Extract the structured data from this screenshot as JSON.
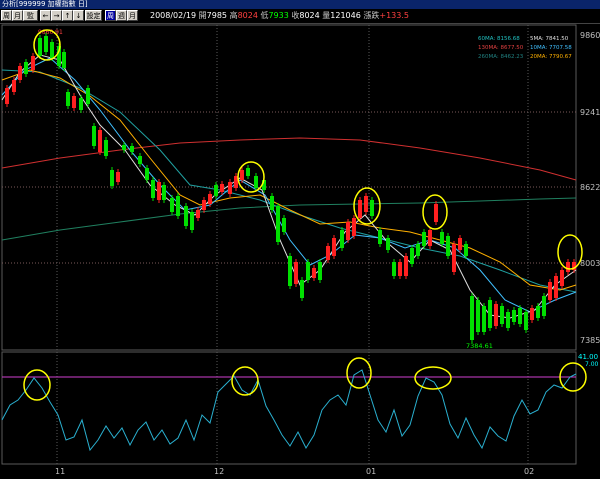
{
  "window": {
    "title": "分析[999999 加權指數 日]"
  },
  "toolbar": {
    "buttons": [
      {
        "label": "周"
      },
      {
        "label": "月"
      },
      {
        "label": "監"
      },
      {
        "label": "←"
      },
      {
        "label": "→"
      },
      {
        "label": "↑"
      },
      {
        "label": "↓"
      },
      {
        "label": "設定"
      },
      {
        "label": "周"
      },
      {
        "label": "週"
      },
      {
        "label": "月"
      }
    ]
  },
  "quote": {
    "date": "2008/02/19",
    "open_label": "開",
    "open": "7985",
    "high_label": "高",
    "high": "8024",
    "low_label": "低",
    "low": "7933",
    "close_label": "收",
    "close": "8024",
    "volume_label": "量",
    "volume": "121046",
    "change_label": "漲跌",
    "change": "+133.5"
  },
  "price_axis": {
    "labels": [
      "9860",
      "9241",
      "8622",
      "8003",
      "7385"
    ]
  },
  "date_axis": {
    "labels": [
      "11",
      "12",
      "01",
      "02"
    ]
  },
  "ma_legend": {
    "left": [
      {
        "label": "60MA: 8156.68",
        "color": "#20c0c0"
      },
      {
        "label": "130MA: 8677.50",
        "color": "#e04040"
      },
      {
        "label": "260MA: 8462.23",
        "color": "#208080"
      }
    ],
    "right": [
      {
        "label": "5MA: 7841.50",
        "color": "#e0e0e0"
      },
      {
        "label": "10MA: 7707.58",
        "color": "#40c0ff"
      },
      {
        "label": "20MA: 7790.67",
        "color": "#ffb000"
      }
    ]
  },
  "annotations": {
    "high_marker": "9860.91",
    "low_marker": "7384.61"
  },
  "indicator": {
    "level_label": "41.00",
    "level_label2": "7.00"
  },
  "colors": {
    "up_candle": "#ff2020",
    "down_candle": "#00e000",
    "ma5": "#e0e0e0",
    "ma10": "#40c0ff",
    "ma20": "#ffb000",
    "ma60": "#20a0a0",
    "ma130": "#d03030",
    "ma260": "#208060",
    "indicator_line": "#2ab0d0",
    "indicator_level": "#d040d0",
    "highlight_circle": "#ffff00"
  }
}
